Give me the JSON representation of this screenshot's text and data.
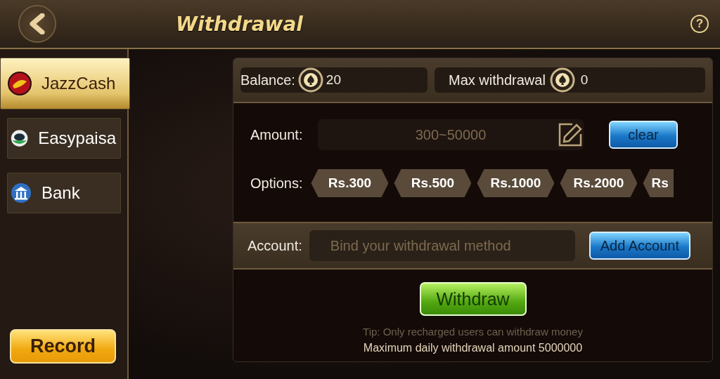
{
  "header": {
    "title": "Withdrawal",
    "help_button": "?"
  },
  "sidebar": {
    "items": [
      {
        "label": "JazzCash",
        "kind": "jazz",
        "selected": true
      },
      {
        "label": "Easypaisa",
        "kind": "easypaisa",
        "selected": false
      },
      {
        "label": "Bank",
        "kind": "bank",
        "selected": false
      }
    ],
    "record_button": "Record"
  },
  "balance": {
    "label": "Balance:",
    "value": "20"
  },
  "max_withdrawal": {
    "label": "Max withdrawal",
    "value": "0"
  },
  "amount": {
    "label": "Amount:",
    "placeholder": "300~50000",
    "clear_button": "clear"
  },
  "options": {
    "label": "Options:",
    "items": [
      "Rs.300",
      "Rs.500",
      "Rs.1000",
      "Rs.2000",
      "Rs"
    ]
  },
  "account": {
    "label": "Account:",
    "placeholder": "Bind your withdrawal method",
    "button": "Add Account"
  },
  "withdraw_button": "Withdraw",
  "tip": "Tip: Only recharged users can withdraw money",
  "daily_limit": "Maximum daily withdrawal amount 5000000"
}
